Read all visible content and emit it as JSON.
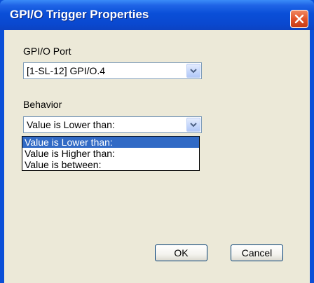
{
  "window": {
    "title": "GPI/O Trigger Properties",
    "close_icon": "close-icon"
  },
  "port": {
    "label": "GPI/O Port",
    "selected": "[1-SL-12] GPI/O.4"
  },
  "behavior": {
    "label": "Behavior",
    "selected": "Value is Lower than:",
    "options": [
      "Value is Lower than:",
      "Value is Higher than:",
      "Value is between:"
    ],
    "highlighted_index": 0
  },
  "buttons": {
    "ok": "OK",
    "cancel": "Cancel"
  },
  "colors": {
    "title_bar": "#0a4fd8",
    "client_bg": "#ece9d8",
    "selection": "#316ac5",
    "close_button": "#e2542a"
  }
}
